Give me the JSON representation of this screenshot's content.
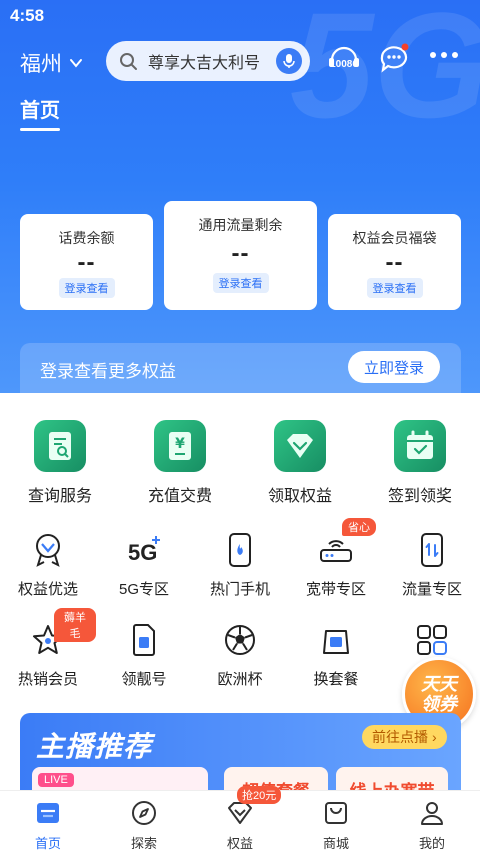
{
  "status_bar": {
    "time": "4:58"
  },
  "header": {
    "city": "福州",
    "search_placeholder": "尊享大吉大利号",
    "service_hotline": "10086",
    "home_tab": "首页"
  },
  "cards": [
    {
      "title": "话费余额",
      "value": "--",
      "button": "登录查看"
    },
    {
      "title": "通用流量剩余",
      "value": "--",
      "button": "登录查看"
    },
    {
      "title": "权益会员福袋",
      "value": "--",
      "button": "登录查看"
    }
  ],
  "login_bar": {
    "text": "登录查看更多权益",
    "button": "立即登录"
  },
  "main_services": [
    {
      "label": "查询服务",
      "icon": "query-document-icon"
    },
    {
      "label": "充值交费",
      "icon": "recharge-yuan-icon"
    },
    {
      "label": "领取权益",
      "icon": "gem-icon"
    },
    {
      "label": "签到领奖",
      "icon": "calendar-check-icon"
    }
  ],
  "grid_row1": [
    {
      "label": "权益优选",
      "icon": "badge-icon"
    },
    {
      "label": "5G专区",
      "icon": "5g-icon"
    },
    {
      "label": "热门手机",
      "icon": "phone-fire-icon"
    },
    {
      "label": "宽带专区",
      "icon": "router-icon",
      "tag": "省心"
    },
    {
      "label": "流量专区",
      "icon": "phone-data-icon"
    }
  ],
  "grid_row2": [
    {
      "label": "热销会员",
      "icon": "star-icon",
      "tag": "薅羊毛"
    },
    {
      "label": "领靓号",
      "icon": "sim-card-icon"
    },
    {
      "label": "欧洲杯",
      "icon": "soccer-ball-icon"
    },
    {
      "label": "换套餐",
      "icon": "package-bag-icon"
    },
    {
      "label": "",
      "icon": "grid-apps-icon"
    }
  ],
  "float_promo": {
    "line1": "天天",
    "line2": "领券"
  },
  "banner": {
    "title": "主播推荐",
    "go_button": "前往点播",
    "live_tag": "LIVE",
    "item2": "超值套餐",
    "item3": "线上办宽带"
  },
  "tabbar": [
    {
      "label": "首页",
      "icon": "home-icon",
      "active": true
    },
    {
      "label": "探索",
      "icon": "compass-icon"
    },
    {
      "label": "权益",
      "icon": "gift-diamond-icon",
      "badge": "抢20元"
    },
    {
      "label": "商城",
      "icon": "shopping-bag-icon"
    },
    {
      "label": "我的",
      "icon": "user-icon"
    }
  ],
  "colors": {
    "brand_blue": "#2a6ff5",
    "green": "#2fc486",
    "orange": "#f5701e",
    "red_tag": "#f5573a"
  }
}
